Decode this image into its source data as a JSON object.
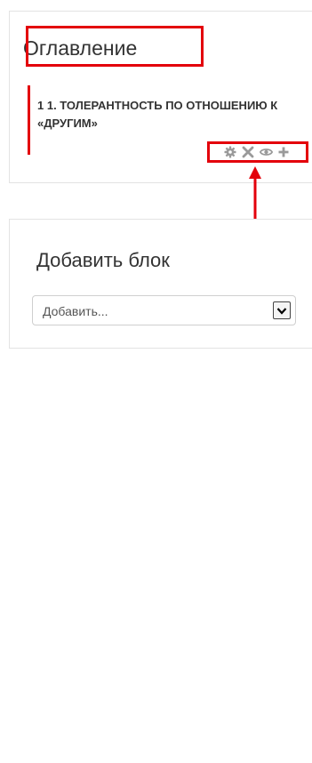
{
  "toc_block": {
    "title": "Оглавление",
    "item": "1 1. Толерантность по отношению к «другим»",
    "controls": [
      {
        "icon": "gear-icon",
        "label": "Редактировать"
      },
      {
        "icon": "close-icon",
        "label": "Удалить"
      },
      {
        "icon": "eye-icon",
        "label": "Скрыть"
      },
      {
        "icon": "plus-icon",
        "label": "Добавить"
      }
    ]
  },
  "add_block": {
    "title": "Добавить блок",
    "select": {
      "selected": "Добавить..."
    }
  },
  "colors": {
    "highlight": "#e3000b",
    "icon": "#9a9a9a"
  }
}
